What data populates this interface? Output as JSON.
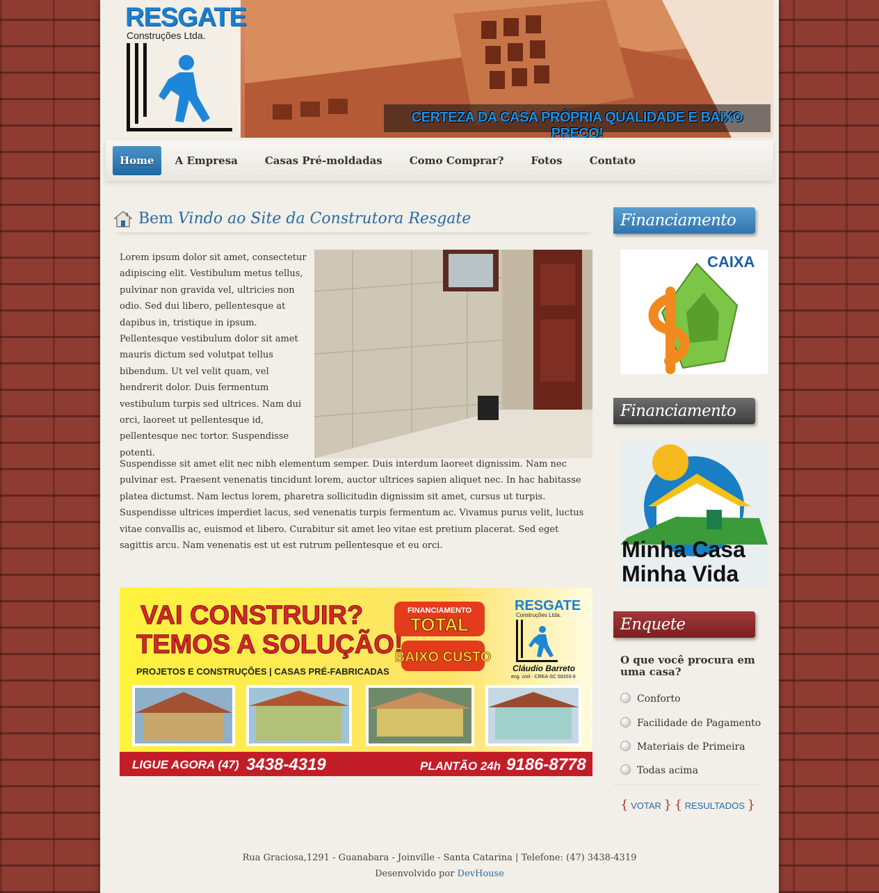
{
  "header": {
    "logo_title": "RESGATE",
    "logo_subtitle": "Construções Ltda.",
    "slogan": "CERTEZA DA CASA PRÓPRIA QUALIDADE E BAIXO PREÇO!"
  },
  "nav": {
    "items": [
      "Home",
      "A Empresa",
      "Casas Pré-moldadas",
      "Como Comprar?",
      "Fotos",
      "Contato"
    ],
    "active": "Home"
  },
  "main": {
    "heading_part1": "Bem ",
    "heading_part2": "Vindo ao Site da Construtora Resgate",
    "para1": "Lorem ipsum dolor sit amet, consectetur adipiscing elit. Vestibulum metus tellus, pulvinar non gravida vel, ultricies non odio. Sed dui libero, pellentesque at dapibus in, tristique in ipsum. Pellentesque vestibulum dolor sit amet mauris dictum sed volutpat tellus bibendum. Ut vel velit quam, vel hendrerit dolor. Duis fermentum vestibulum turpis sed ultrices. Nam dui orci, laoreet ut pellentesque id, pellentesque nec tortor. Suspendisse potenti.",
    "para2": "Suspendisse sit amet elit nec nibh elementum semper. Duis interdum laoreet dignissim. Nam nec pulvinar est. Praesent venenatis tincidunt lorem, auctor ultrices sapien aliquet nec. In hac habitasse platea dictumst. Nam lectus lorem, pharetra sollicitudin dignissim sit amet, cursus ut turpis. Suspendisse ultrices imperdiet lacus, sed venenatis turpis fermentum ac. Vivamus purus velit, luctus vitae convallis ac, euismod et libero. Curabitur sit amet leo vitae est pretium placerat. Sed eget sagittis arcu. Nam venenatis est ut est rutrum pellentesque et eu orci."
  },
  "banner": {
    "line1": "VAI CONSTRUIR?",
    "line2": "TEMOS A SOLUÇÃO!",
    "badge_top": "FINANCIAMENTO",
    "badge_total": "TOTAL",
    "badge_low": "BAIXO CUSTO",
    "services": "PROJETOS E CONSTRUÇÕES | CASAS PRÉ-FABRICADAS",
    "logo_title": "RESGATE",
    "logo_sub": "Construções Ltda.",
    "engineer": "Cláudio Barreto",
    "engineer_sub": "eng. civil - CREA-SC 59203-9",
    "call_label": "LIGUE AGORA (47)",
    "call_number": "3438-4319",
    "duty_label": "PLANTÃO 24h",
    "duty_number": "9186-8778"
  },
  "sidebar": {
    "fin1_title": "Financiamento",
    "caixa_label": "CAIXA",
    "fin2_title": "Financiamento",
    "mcmv_line1": "Minha Casa",
    "mcmv_line2": "Minha Vida",
    "poll_title": "Enquete",
    "poll_question": "O que você procura em uma casa?",
    "poll_options": [
      "Conforto",
      "Facilidade de Pagamento",
      "Materiais de Primeira",
      "Todas acima"
    ],
    "vote_label": "VOTAR",
    "results_label": "RESULTADOS"
  },
  "footer": {
    "address": "Rua Graciosa,1291 - Guanabara - Joinville - Santa Catarina | Telefone: (47) 3438-4319",
    "dev_prefix": "Desenvolvido por ",
    "dev_link": "DevHouse"
  },
  "colors": {
    "accent_blue": "#2a6aa5",
    "nav_active": "#1f69a4",
    "poll_red": "#7c2022",
    "brick": "#8e3b32"
  }
}
